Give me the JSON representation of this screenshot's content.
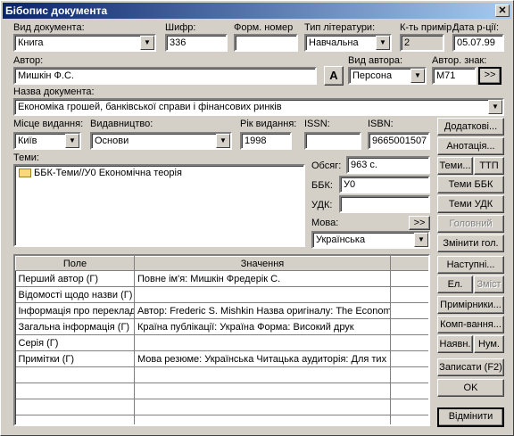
{
  "window": {
    "title": "Бібопис документа",
    "close_label": "✕"
  },
  "fields": {
    "doc_type": {
      "label": "Вид документа:",
      "value": "Книга"
    },
    "cipher": {
      "label": "Шифр:",
      "value": "336"
    },
    "form_number": {
      "label": "Форм. номер",
      "value": ""
    },
    "lit_type": {
      "label": "Тип літератури:",
      "value": "Навчальна"
    },
    "copies": {
      "label": "К-ть примір.:",
      "value": "2"
    },
    "entry_date": {
      "label": "Дата р-ції:",
      "value": "05.07.99"
    },
    "author": {
      "label": "Автор:",
      "value": "Мишкін Ф.С."
    },
    "author_font_btn": "A",
    "author_type": {
      "label": "Вид автора:",
      "value": "Персона"
    },
    "author_sign": {
      "label": "Автор. знак:",
      "value": "М71",
      "btn": ">>"
    },
    "doc_name": {
      "label": "Назва документа:",
      "value": "Економіка грошей, банківської справи і фінансових ринків"
    },
    "pub_place": {
      "label": "Місце видання:",
      "value": "Київ"
    },
    "publisher": {
      "label": "Видавництво:",
      "value": "Основи"
    },
    "pub_year": {
      "label": "Рік видання:",
      "value": "1998"
    },
    "issn": {
      "label": "ISSN:",
      "value": ""
    },
    "isbn": {
      "label": "ISBN:",
      "value": "9665001507"
    },
    "topics": {
      "label": "Теми:",
      "items": [
        "ББК-Теми//У0 Економічна теорія"
      ]
    },
    "volume": {
      "label": "Обсяг:",
      "value": "963 с."
    },
    "bbk": {
      "label": "ББК:",
      "value": "У0"
    },
    "udk": {
      "label": "УДК:",
      "value": ""
    },
    "language": {
      "label": "Мова:",
      "value": "Українська",
      "btn": ">>"
    }
  },
  "table": {
    "headers": [
      "Поле",
      "Значення"
    ],
    "rows": [
      [
        "Перший автор (Г)",
        "Повне ім'я: Мишкін Фредерік С."
      ],
      [
        "Відомості щодо назви (Г)",
        ""
      ],
      [
        "Інформація про переклад",
        "Автор: Frederic S. Mishkin Назва оригіналу: The Economic"
      ],
      [
        "Загальна інформація (Г)",
        "Країна публікації: Україна Форма: Високий друк"
      ],
      [
        "Серія (Г)",
        ""
      ],
      [
        "Примітки (Г)",
        "Мова резюме: Українська Читацька аудиторія: Для тих"
      ],
      [
        "",
        ""
      ],
      [
        "",
        ""
      ],
      [
        "",
        ""
      ],
      [
        "",
        ""
      ],
      [
        "",
        ""
      ]
    ]
  },
  "buttons": {
    "additional": "Додаткові...",
    "annotation": "Анотація...",
    "topics": "Теми...",
    "ttp": "ТТП",
    "topics_bbk": "Теми ББК",
    "topics_udk": "Теми УДК",
    "main": "Головний",
    "change_main": "Змінити гол.",
    "next": "Наступні...",
    "el": "Ел.",
    "contents": "Зміст",
    "copies": "Примірники...",
    "completion": "Комп-вання...",
    "availability": "Наявн.",
    "num": "Нум.",
    "save": "Записати (F2)",
    "ok": "OK",
    "cancel": "Відмінити"
  }
}
